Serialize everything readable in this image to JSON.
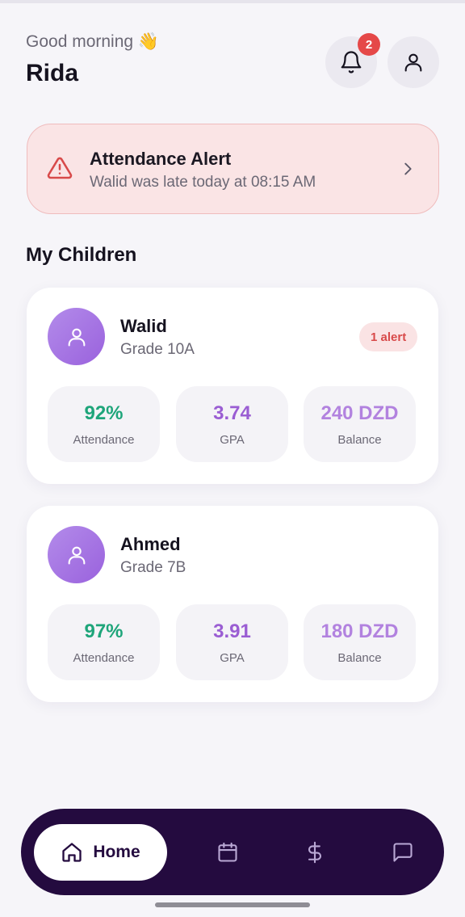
{
  "header": {
    "greeting": "Good morning 👋",
    "user_name": "Rida",
    "notification_count": "2"
  },
  "alert": {
    "title": "Attendance Alert",
    "message": "Walid was late today at 08:15 AM"
  },
  "section_title": "My Children",
  "children": [
    {
      "name": "Walid",
      "grade": "Grade 10A",
      "alert_badge": "1 alert",
      "stats": [
        {
          "value": "92%",
          "label": "Attendance"
        },
        {
          "value": "3.74",
          "label": "GPA"
        },
        {
          "value": "240 DZD",
          "label": "Balance"
        }
      ]
    },
    {
      "name": "Ahmed",
      "grade": "Grade 7B",
      "stats": [
        {
          "value": "97%",
          "label": "Attendance"
        },
        {
          "value": "3.91",
          "label": "GPA"
        },
        {
          "value": "180 DZD",
          "label": "Balance"
        }
      ]
    }
  ],
  "nav": {
    "home_label": "Home",
    "items": [
      "home-icon",
      "calendar-icon",
      "dollar-icon",
      "chat-icon"
    ]
  },
  "colors": {
    "background": "#f6f5f9",
    "alert_bg": "#fae4e5",
    "alert_red": "#d84a4a",
    "nav_bg": "#240b3f",
    "attendance_green": "#1ea57a",
    "gpa_purple": "#9a5dd3",
    "balance_lilac": "#b282df"
  }
}
